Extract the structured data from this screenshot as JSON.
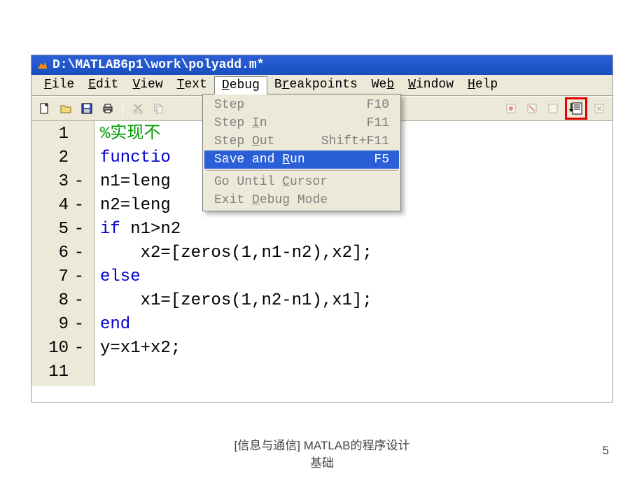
{
  "titlebar": {
    "path": "D:\\MATLAB6p1\\work\\polyadd.m*"
  },
  "menubar": {
    "file": "File",
    "edit": "Edit",
    "view": "View",
    "text": "Text",
    "debug": "Debug",
    "breakpoints": "Breakpoints",
    "web": "Web",
    "window": "Window",
    "help": "Help"
  },
  "debug_menu": {
    "items": [
      {
        "label": "Step",
        "shortcut": "F10",
        "enabled": false
      },
      {
        "label": "Step In",
        "shortcut": "F11",
        "enabled": false
      },
      {
        "label": "Step Out",
        "shortcut": "Shift+F11",
        "enabled": false
      },
      {
        "label": "Save and Run",
        "shortcut": "F5",
        "enabled": true,
        "selected": true
      },
      {
        "label": "Go Until Cursor",
        "shortcut": "",
        "enabled": false
      },
      {
        "label": "Exit Debug Mode",
        "shortcut": "",
        "enabled": false
      }
    ]
  },
  "code": {
    "lines": [
      {
        "n": 1,
        "dash": "",
        "frags": [
          {
            "t": "%实现不",
            "c": "comment"
          }
        ]
      },
      {
        "n": 2,
        "dash": "",
        "frags": [
          {
            "t": "functio",
            "c": "key"
          }
        ]
      },
      {
        "n": 3,
        "dash": "-",
        "frags": [
          {
            "t": "n1=leng",
            "c": "text"
          }
        ]
      },
      {
        "n": 4,
        "dash": "-",
        "frags": [
          {
            "t": "n2=leng",
            "c": "text"
          }
        ]
      },
      {
        "n": 5,
        "dash": "-",
        "frags": [
          {
            "t": "if ",
            "c": "key"
          },
          {
            "t": "n1>n2",
            "c": "text"
          }
        ]
      },
      {
        "n": 6,
        "dash": "-",
        "frags": [
          {
            "t": "    x2=[zeros(1,n1-n2),x2];",
            "c": "text"
          }
        ]
      },
      {
        "n": 7,
        "dash": "-",
        "frags": [
          {
            "t": "else",
            "c": "key"
          }
        ]
      },
      {
        "n": 8,
        "dash": "-",
        "frags": [
          {
            "t": "    x1=[zeros(1,n2-n1),x1];",
            "c": "text"
          }
        ]
      },
      {
        "n": 9,
        "dash": "-",
        "frags": [
          {
            "t": "end",
            "c": "key"
          }
        ]
      },
      {
        "n": 10,
        "dash": "-",
        "frags": [
          {
            "t": "y=x1+x2;",
            "c": "text"
          }
        ]
      },
      {
        "n": 11,
        "dash": "",
        "frags": []
      }
    ]
  },
  "footer": {
    "line1": "[信息与通信] MATLAB的程序设计",
    "line2": "基础",
    "page": "5"
  }
}
